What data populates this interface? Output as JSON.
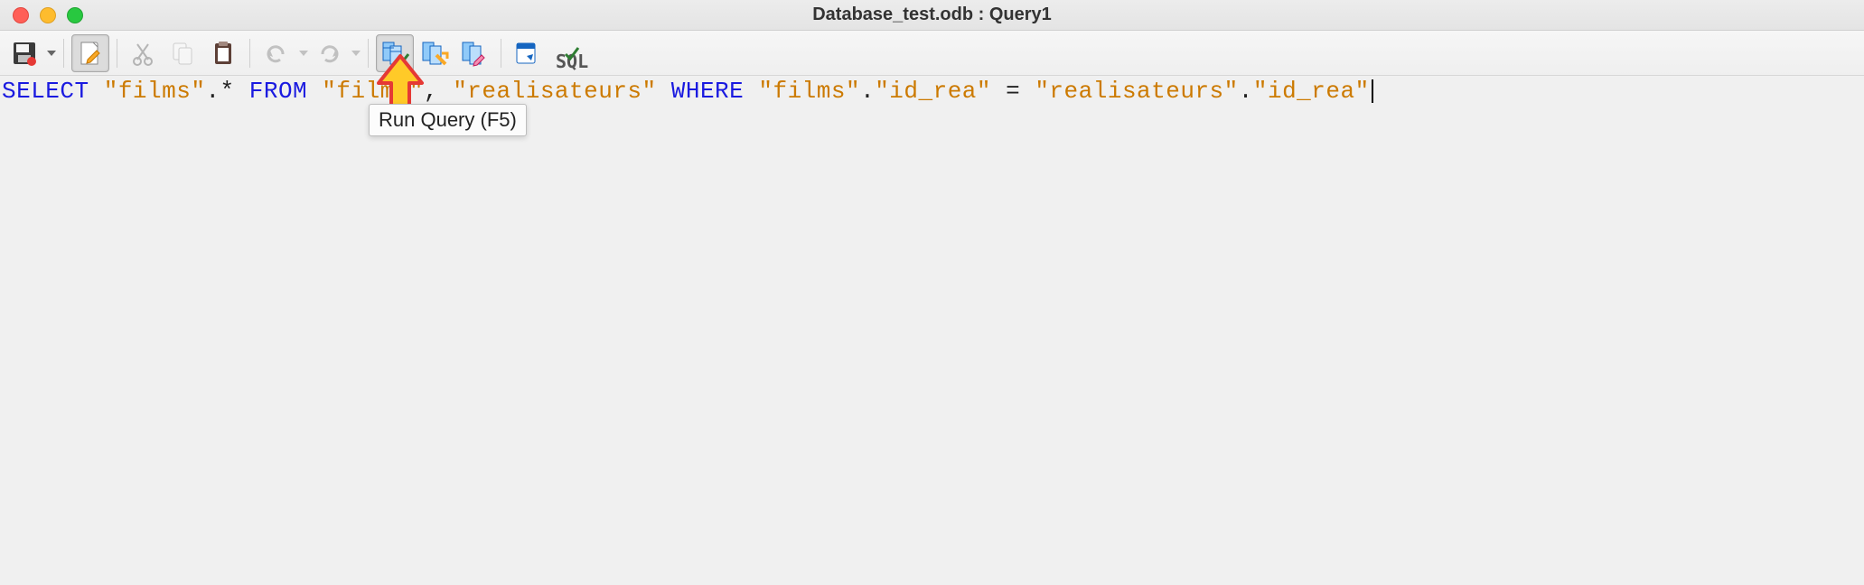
{
  "window": {
    "title": "Database_test.odb : Query1"
  },
  "toolbar": {
    "save": "save-icon",
    "edit_file": "edit-file-icon",
    "cut": "cut-icon",
    "copy": "copy-icon",
    "paste": "paste-icon",
    "undo": "undo-icon",
    "redo": "redo-icon",
    "run_query": "run-query-icon",
    "clear_query": "clear-query-icon",
    "design_view": "design-view-icon",
    "add_table": "add-table-icon",
    "sql_label": "SQL"
  },
  "tooltip": {
    "run_query": "Run Query (F5)"
  },
  "sql": {
    "tokens": [
      {
        "t": "kw",
        "v": "SELECT "
      },
      {
        "t": "str",
        "v": "\"films\""
      },
      {
        "t": "op",
        "v": ".* "
      },
      {
        "t": "kw",
        "v": "FROM "
      },
      {
        "t": "str",
        "v": "\"films\""
      },
      {
        "t": "op",
        "v": ", "
      },
      {
        "t": "str",
        "v": "\"realisateurs\""
      },
      {
        "t": "kw",
        "v": " WHERE "
      },
      {
        "t": "str",
        "v": "\"films\""
      },
      {
        "t": "op",
        "v": "."
      },
      {
        "t": "str",
        "v": "\"id_rea\""
      },
      {
        "t": "op",
        "v": " = "
      },
      {
        "t": "str",
        "v": "\"realisateurs\""
      },
      {
        "t": "op",
        "v": "."
      },
      {
        "t": "str",
        "v": "\"id_rea\""
      }
    ]
  }
}
